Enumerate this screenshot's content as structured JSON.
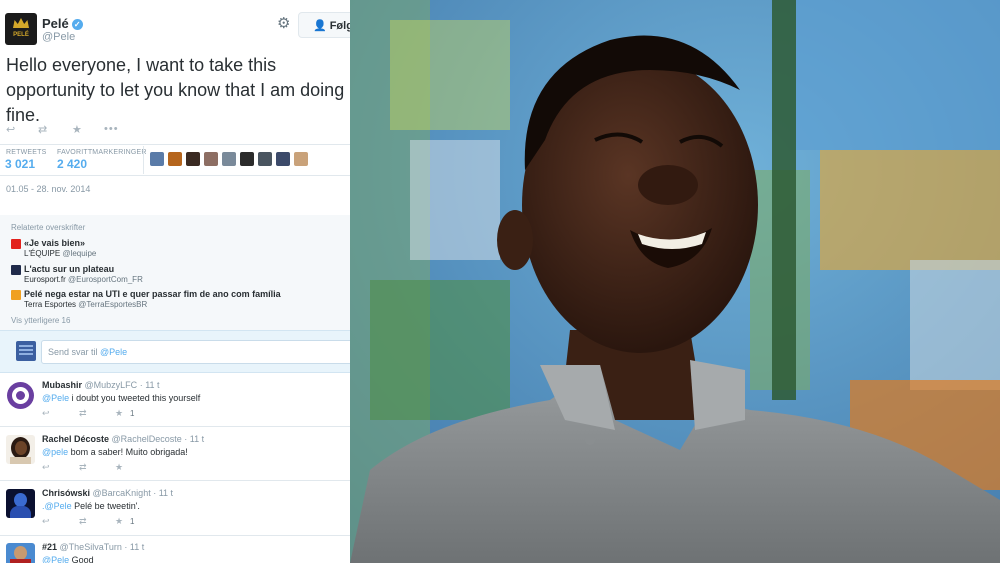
{
  "tweet": {
    "name": "Pelé",
    "handle": "@Pele",
    "avatar_text": "PELÉ",
    "follow_label": "Følg",
    "text": "Hello everyone, I want to take this opportunity to let you know that I am doing fine.",
    "retweets_label": "RETWEETS",
    "retweets_value": "3 021",
    "favorites_label": "FAVORITTMARKERINGER",
    "favorites_value": "2 420",
    "date": "01.05 - 28. nov. 2014"
  },
  "related": {
    "title": "Relaterte overskrifter",
    "items": [
      {
        "headline": "«Je vais bien»",
        "source": "L'ÉQUIPE",
        "handle": "@lequipe",
        "icon_color": "#e2211c"
      },
      {
        "headline": "L'actu sur un plateau",
        "source": "Eurosport.fr",
        "handle": "@EurosportCom_FR",
        "icon_color": "#1f2a4a"
      },
      {
        "headline": "Pelé nega estar na UTI e quer passar fim de ano com família",
        "source": "Terra Esportes",
        "handle": "@TerraEsportesBR",
        "icon_color": "#f0a020"
      }
    ],
    "more": "Vis ytterligere 16"
  },
  "reply_box": {
    "placeholder_prefix": "Send svar til ",
    "mention": "@Pele"
  },
  "replies": [
    {
      "name": "Mubashir",
      "handle": "@MubzyLFC",
      "time": "· 11 t",
      "mention": "@Pele",
      "text": " i doubt you tweeted this yourself",
      "count": "1"
    },
    {
      "name": "Rachel Décoste",
      "handle": "@RachelDecoste",
      "time": "· 11 t",
      "mention": "@pele",
      "text": " bom a saber! Muito obrigada!",
      "count": ""
    },
    {
      "name": "Chrisówski",
      "handle": "@BarcaKnight",
      "time": "· 11 t",
      "mention": ".@Pele",
      "text": " Pelé be tweetin'.",
      "count": "1"
    },
    {
      "name": "#21",
      "handle": "@TheSilvaTurn",
      "time": "· 11 t",
      "mention": "@Pele",
      "text": " Good",
      "count": ""
    }
  ],
  "colors": {
    "link": "#55acee",
    "text": "#292f33",
    "muted": "#8899a6"
  }
}
